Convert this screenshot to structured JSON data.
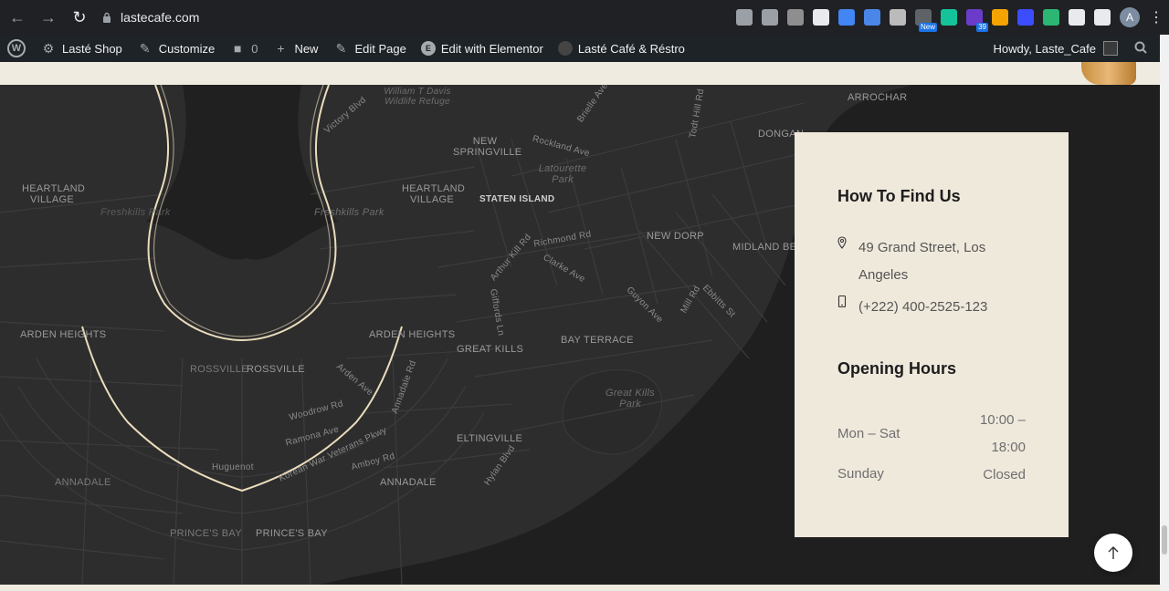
{
  "browser": {
    "url": "lastecafe.com",
    "extensions": [
      {
        "name": "share-icon",
        "color": "#9aa0a6"
      },
      {
        "name": "star-icon",
        "color": "#9aa0a6"
      },
      {
        "name": "recycle-icon",
        "color": "#8e8e8e"
      },
      {
        "name": "globe-icon",
        "color": "#e8eaed"
      },
      {
        "name": "docs-icon",
        "color": "#4285f4"
      },
      {
        "name": "translate-icon",
        "color": "#4a86e8"
      },
      {
        "name": "camera-icon",
        "color": "#bbbbbb"
      },
      {
        "name": "new-ext-icon",
        "color": "#5f6368",
        "badge": "New"
      },
      {
        "name": "grammarly-icon",
        "color": "#15c39a"
      },
      {
        "name": "counter-ext-icon",
        "color": "#6a3cc9",
        "badge": "39"
      },
      {
        "name": "bolt-ext-icon",
        "color": "#f4a300"
      },
      {
        "name": "screen-record-icon",
        "color": "#3c4cff"
      },
      {
        "name": "color-ext-icon",
        "color": "#2bb673"
      },
      {
        "name": "puzzle-icon",
        "color": "#e8eaed"
      },
      {
        "name": "sidebar-icon",
        "color": "#e8eaed"
      }
    ],
    "avatar_letter": "A"
  },
  "admin_bar": {
    "shop": "Lasté Shop",
    "customize": "Customize",
    "comments_count": "0",
    "new": "New",
    "edit_page": "Edit Page",
    "elementor": "Edit with Elementor",
    "site": "Lasté Café & Réstro",
    "howdy": "Howdy, Laste_Cafe"
  },
  "map_labels": {
    "davis": "William T Davis Wildlife Refuge",
    "heartland_left": "HEARTLAND VILLAGE",
    "heartland": "HEARTLAND VILLAGE",
    "new_springville": "NEW SPRINGVILLE",
    "staten_island": "STATEN ISLAND",
    "latourette": "Latourette Park",
    "freshkills": "Freshkills Park",
    "freshkills_left": "Freshkills Park",
    "new_dorp": "NEW DORP",
    "midland": "MIDLAND BEACH",
    "dongan": "DONGAN",
    "arrochar": "ARROCHAR",
    "arden_left": "ARDEN HEIGHTS",
    "arden": "ARDEN HEIGHTS",
    "great_kills": "GREAT KILLS",
    "bay_terrace": "BAY TERRACE",
    "great_kills_park": "Great Kills Park",
    "rossville": "ROSSVILLE",
    "rossville_left": "ROSSVILLE",
    "eltingville": "ELTINGVILLE",
    "annadale": "ANNADALE",
    "annadale_left": "ANNADALE",
    "huguenot": "Huguenot",
    "princes_bay": "PRINCE'S BAY",
    "princes_bay_left": "PRINCE'S BAY",
    "rockland": "Rockland Ave",
    "richmond_rd": "Richmond Rd",
    "arthur_kill": "Arthur Kill Rd",
    "woodrow": "Woodrow Rd",
    "ramona": "Ramona Ave",
    "korean": "Korean War Veterans Pkwy",
    "amboy": "Amboy Rd",
    "hylan": "Hylan Blvd",
    "victory": "Victory Blvd",
    "brielle": "Brielle Ave",
    "todt": "Todt Hill Rd",
    "clarke": "Clarke Ave",
    "guyon": "Guyon Ave",
    "mill": "Mill Rd",
    "ebbitts": "Ebbitts St",
    "giffords": "Giffords Ln",
    "arden_ave": "Arden Ave",
    "annadale_rd": "Annadale Rd"
  },
  "find_us": {
    "title": "How To Find Us",
    "address": "49 Grand Street, Los Angeles",
    "phone": "(+222) 400-2525-123"
  },
  "hours": {
    "title": "Opening Hours",
    "rows": [
      {
        "day": "Mon – Sat",
        "time": "10:00 – 18:00"
      },
      {
        "day": "Sunday",
        "time": "Closed"
      }
    ]
  }
}
